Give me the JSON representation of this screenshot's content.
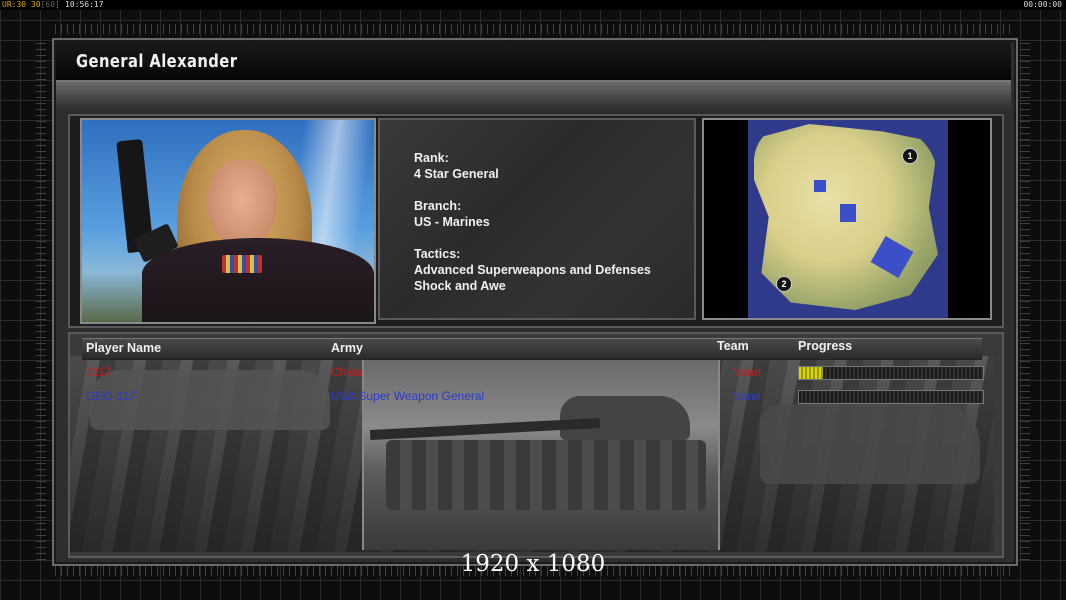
{
  "overlay": {
    "fps_label": "UR",
    "fps_value": "30",
    "fps_current": "30",
    "fps_limit": "[60]",
    "clock": "10:56:17",
    "timer": "00:00:00"
  },
  "general": {
    "name": "General Alexander",
    "rank_label": "Rank:",
    "rank": "4 Star General",
    "branch_label": "Branch:",
    "branch": "US - Marines",
    "tactics_label": "Tactics:",
    "tactics": [
      "Advanced Superweapons and Defenses",
      "Shock and Awe"
    ]
  },
  "minimap": {
    "start_markers": [
      "1",
      "2"
    ],
    "colors": {
      "water": "#2f3a8a",
      "land": "#d9cf8a"
    }
  },
  "players_table": {
    "headers": {
      "player_name": "Player Name",
      "army": "Army",
      "team": "Team",
      "progress": "Progress"
    },
    "rows": [
      {
        "player": "3117",
        "army": "China",
        "team": "None",
        "progress": 0.13,
        "color": "#d01818"
      },
      {
        "player": "GEO-117",
        "army": "USA Super Weapon General",
        "team": "None",
        "progress": 0.0,
        "color": "#2a3ad0"
      }
    ]
  },
  "resolution_caption": "1920 x 1080",
  "colors": {
    "accent": "#f0f0f0",
    "progress_fill": "#d8d400"
  }
}
